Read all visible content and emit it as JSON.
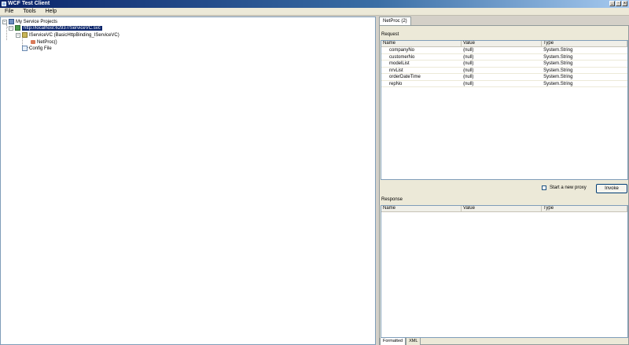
{
  "window": {
    "title": "WCF Test Client",
    "controls": [
      "_",
      "·",
      "x"
    ]
  },
  "menu": {
    "items": [
      "File",
      "Tools",
      "Help"
    ]
  },
  "tree": {
    "root": "My Service Projects",
    "endpoint": "http://localhost:62937/ServiceVC.svc",
    "contract": "IServiceVC (BasicHttpBinding_IServiceVC)",
    "operation": "NetProc()",
    "config": "Config File"
  },
  "document": {
    "tab_label": "NetProc (2)",
    "request": {
      "label": "Request",
      "columns": [
        "Name",
        "Value",
        "Type"
      ],
      "rows": [
        {
          "name": "companyNo",
          "value": "(null)",
          "type": "System.String"
        },
        {
          "name": "customerNo",
          "value": "(null)",
          "type": "System.String"
        },
        {
          "name": "modelList",
          "value": "(null)",
          "type": "System.String"
        },
        {
          "name": "nrvList",
          "value": "(null)",
          "type": "System.String"
        },
        {
          "name": "orderDateTime",
          "value": "(null)",
          "type": "System.String"
        },
        {
          "name": "repNo",
          "value": "(null)",
          "type": "System.String"
        }
      ]
    },
    "start_new_proxy_label": "Start a new proxy",
    "invoke_label": "Invoke",
    "response": {
      "label": "Response",
      "columns": [
        "Name",
        "Value",
        "Type"
      ]
    },
    "bottom_tabs": [
      "Formatted",
      "XML"
    ]
  }
}
